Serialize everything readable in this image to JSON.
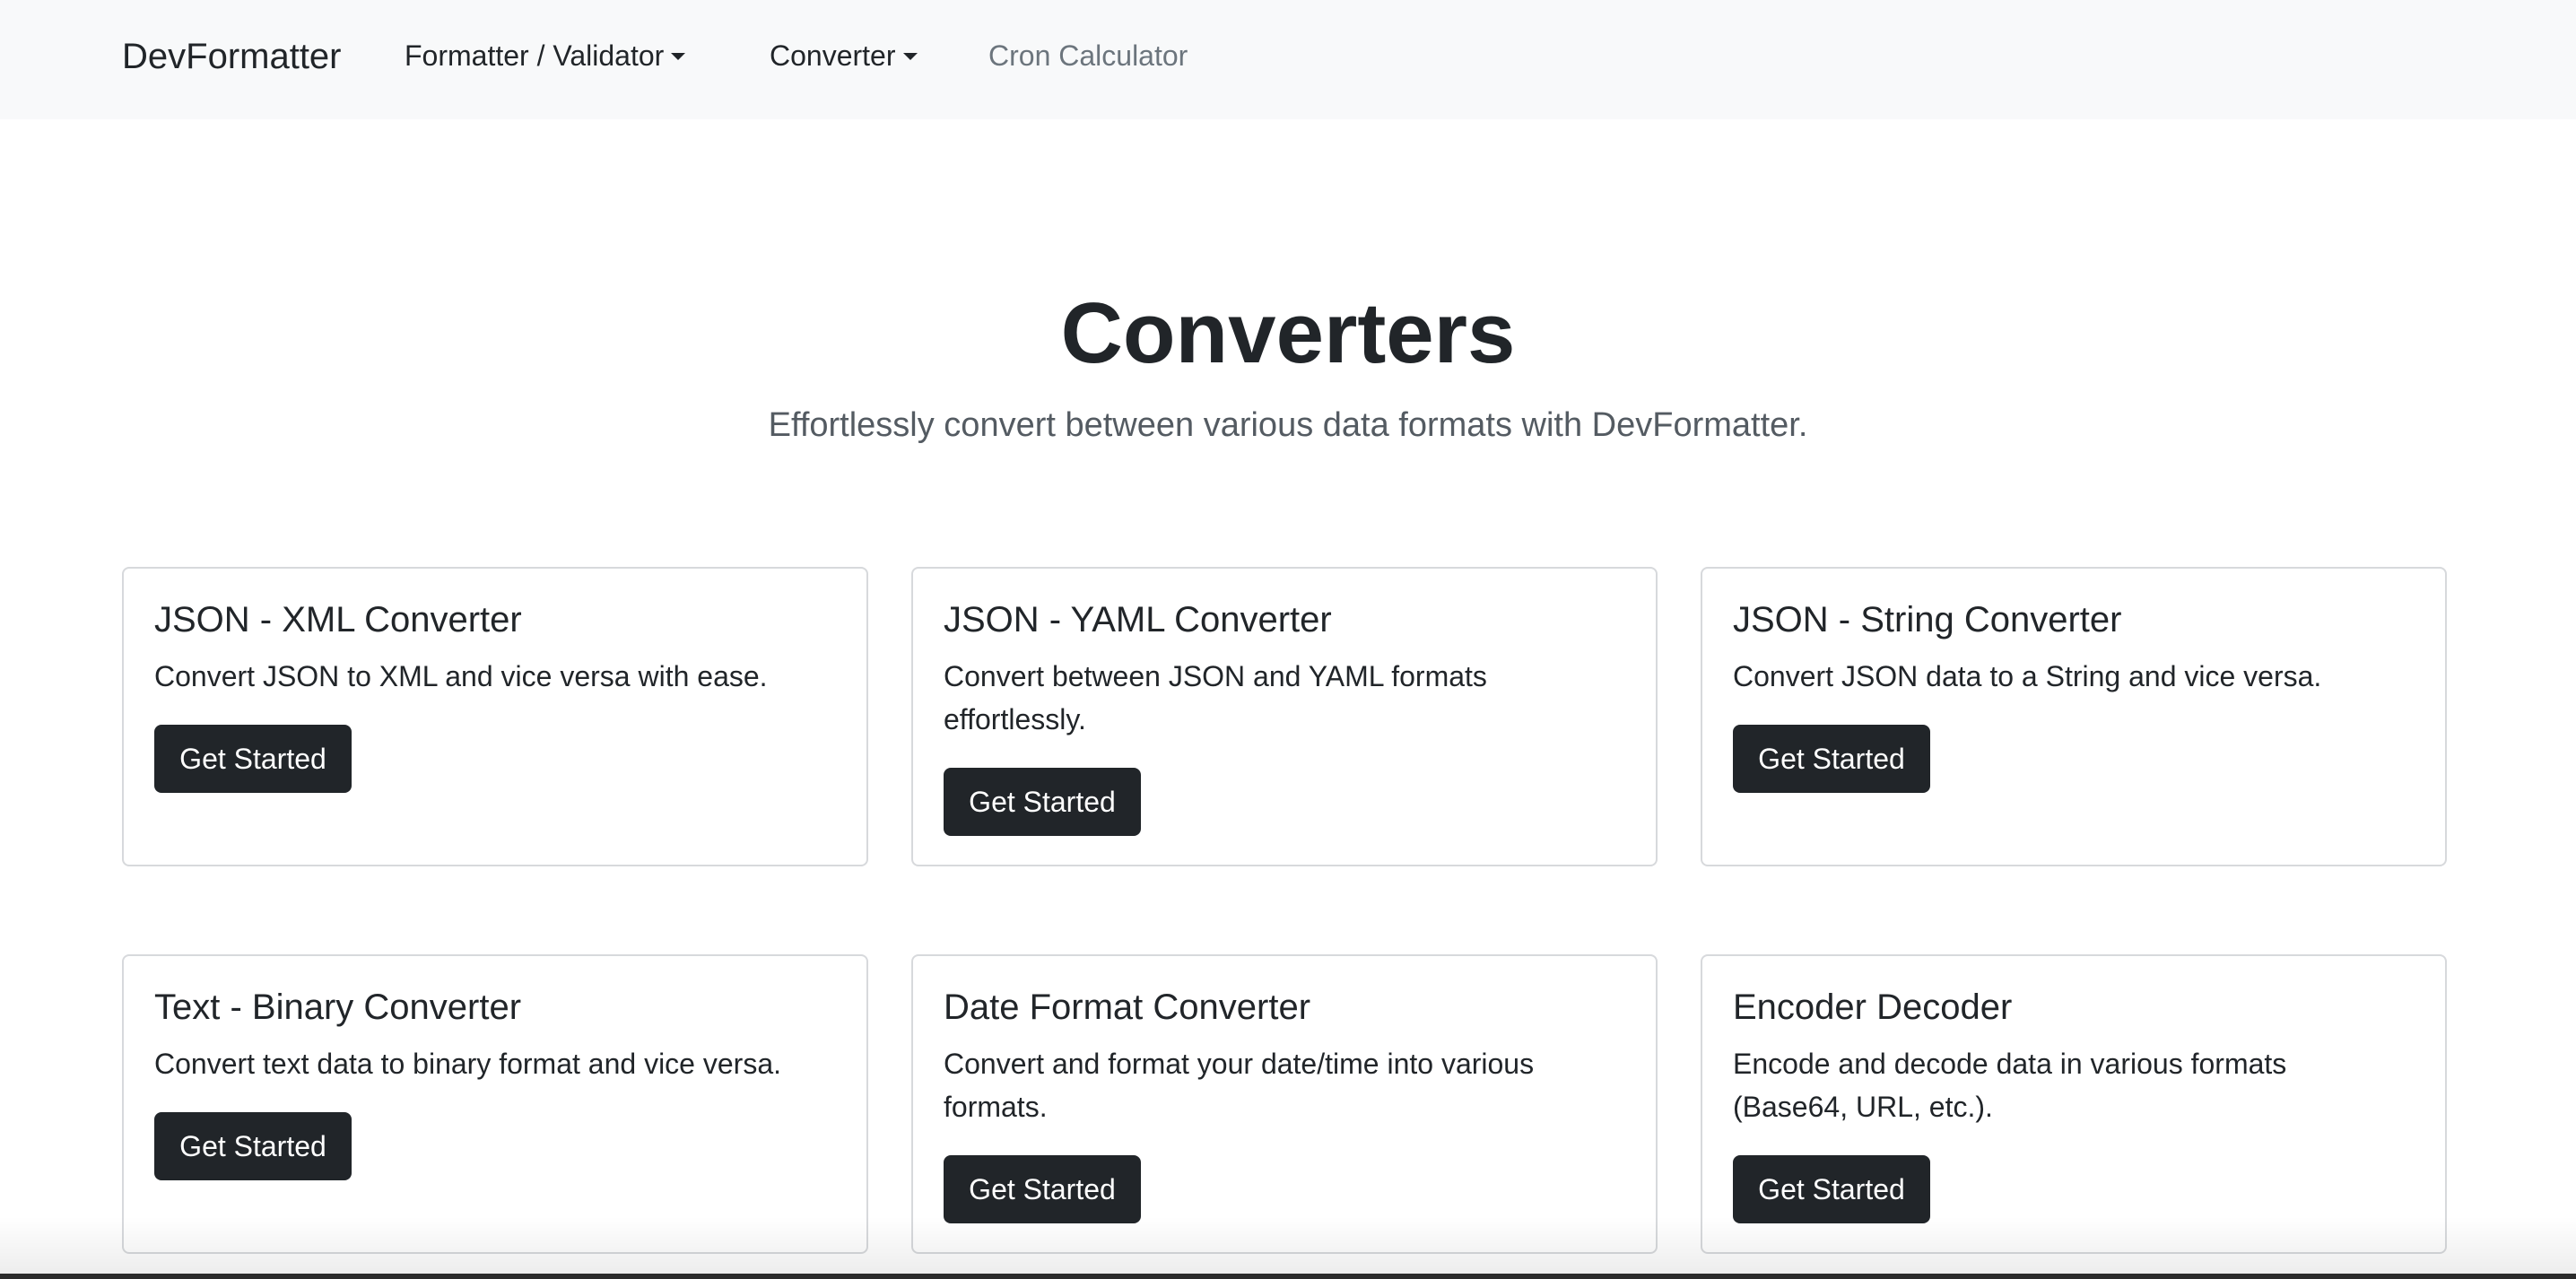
{
  "navbar": {
    "brand": "DevFormatter",
    "items": [
      {
        "label": "Formatter / Validator",
        "dropdown": true
      },
      {
        "label": "Converter",
        "dropdown": true
      },
      {
        "label": "Cron Calculator",
        "dropdown": false
      }
    ]
  },
  "hero": {
    "title": "Converters",
    "subtitle": "Effortlessly convert between various data formats with DevFormatter."
  },
  "cards": [
    {
      "title": "JSON - XML Converter",
      "text": "Convert JSON to XML and vice versa with ease.",
      "button": "Get Started"
    },
    {
      "title": "JSON - YAML Converter",
      "text": "Convert between JSON and YAML formats effortlessly.",
      "button": "Get Started"
    },
    {
      "title": "JSON - String Converter",
      "text": "Convert JSON data to a String and vice versa.",
      "button": "Get Started"
    },
    {
      "title": "Text - Binary Converter",
      "text": "Convert text data to binary format and vice versa.",
      "button": "Get Started"
    },
    {
      "title": "Date Format Converter",
      "text": "Convert and format your date/time into various formats.",
      "button": "Get Started"
    },
    {
      "title": "Encoder Decoder",
      "text": "Encode and decode data in various formats (Base64, URL, etc.).",
      "button": "Get Started"
    }
  ],
  "colors": {
    "navbar_bg": "#f8f9fa",
    "button_bg": "#212529",
    "button_text": "#ffffff",
    "muted_nav": "#6c757d"
  }
}
